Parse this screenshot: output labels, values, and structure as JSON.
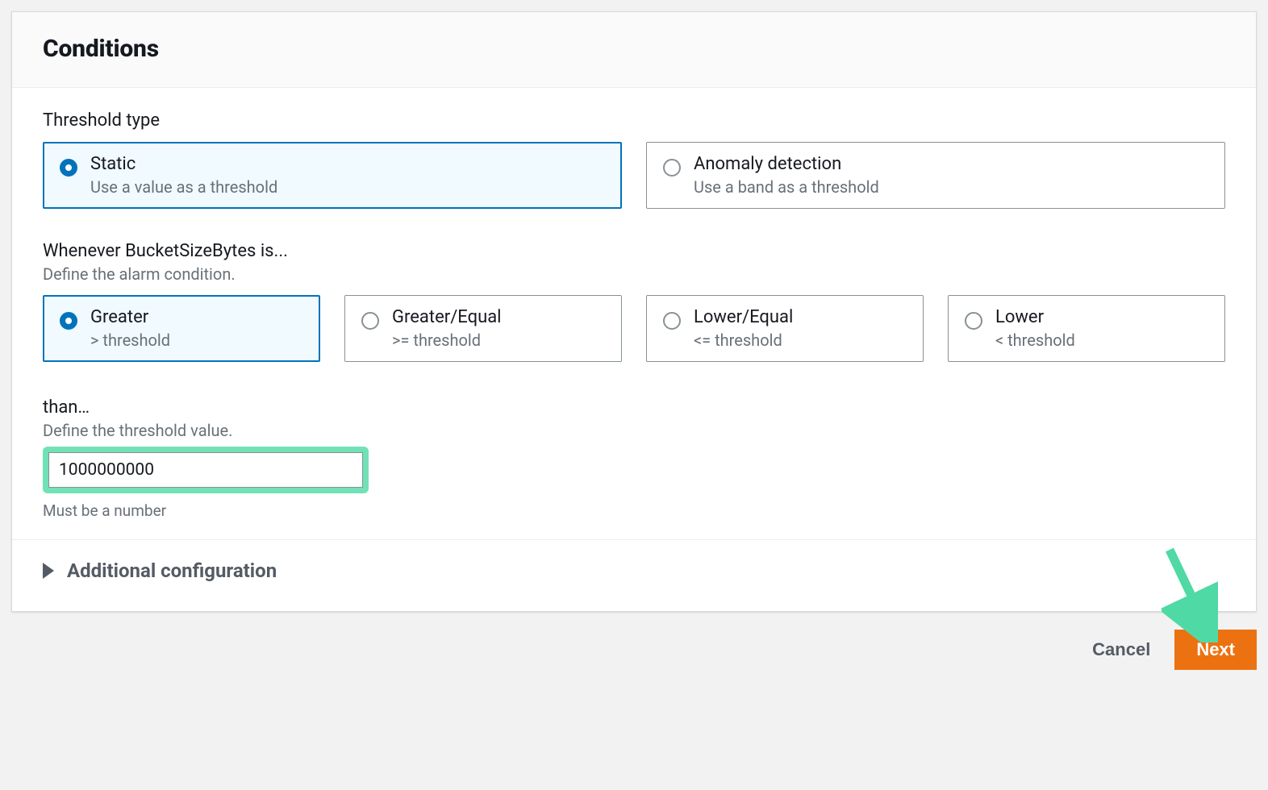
{
  "panel": {
    "title": "Conditions"
  },
  "threshold_type": {
    "label": "Threshold type",
    "options": [
      {
        "title": "Static",
        "sub": "Use a value as a threshold"
      },
      {
        "title": "Anomaly detection",
        "sub": "Use a band as a threshold"
      }
    ]
  },
  "condition": {
    "label": "Whenever BucketSizeBytes is...",
    "helper": "Define the alarm condition.",
    "options": [
      {
        "title": "Greater",
        "sub": "> threshold"
      },
      {
        "title": "Greater/Equal",
        "sub": ">= threshold"
      },
      {
        "title": "Lower/Equal",
        "sub": "<= threshold"
      },
      {
        "title": "Lower",
        "sub": "< threshold"
      }
    ]
  },
  "threshold_value": {
    "label": "than…",
    "helper": "Define the threshold value.",
    "value": "1000000000",
    "constraint": "Must be a number"
  },
  "additional": {
    "label": "Additional configuration"
  },
  "footer": {
    "cancel": "Cancel",
    "next": "Next"
  }
}
